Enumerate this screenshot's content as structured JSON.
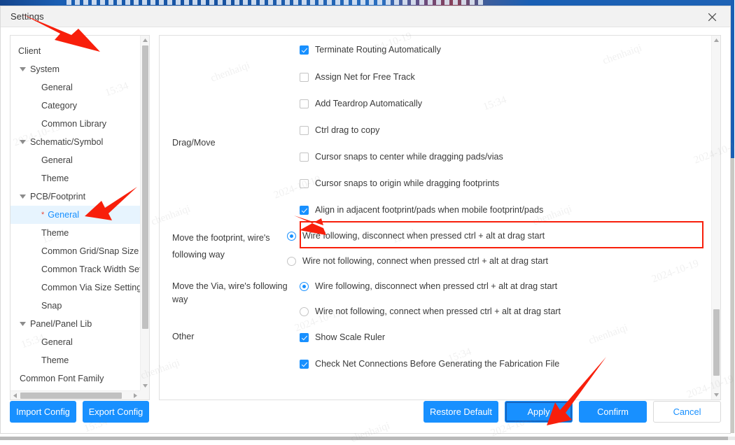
{
  "window": {
    "title": "Settings",
    "close_icon": "close-icon"
  },
  "sidebar": {
    "items": [
      {
        "label": "Client",
        "level": 0,
        "caret": false,
        "selected": false
      },
      {
        "label": "System",
        "level": 1,
        "caret": true,
        "selected": false
      },
      {
        "label": "General",
        "level": 2,
        "caret": false,
        "selected": false
      },
      {
        "label": "Category",
        "level": 2,
        "caret": false,
        "selected": false
      },
      {
        "label": "Common Library",
        "level": 2,
        "caret": false,
        "selected": false
      },
      {
        "label": "Schematic/Symbol",
        "level": 1,
        "caret": true,
        "selected": false
      },
      {
        "label": "General",
        "level": 2,
        "caret": false,
        "selected": false
      },
      {
        "label": "Theme",
        "level": 2,
        "caret": false,
        "selected": false
      },
      {
        "label": "PCB/Footprint",
        "level": 1,
        "caret": true,
        "selected": false
      },
      {
        "label": "General",
        "level": 2,
        "caret": false,
        "selected": true,
        "star": true
      },
      {
        "label": "Theme",
        "level": 2,
        "caret": false,
        "selected": false
      },
      {
        "label": "Common Grid/Snap Size Se",
        "level": 2,
        "caret": false,
        "selected": false
      },
      {
        "label": "Common Track Width Settin",
        "level": 2,
        "caret": false,
        "selected": false
      },
      {
        "label": "Common Via Size Setting",
        "level": 2,
        "caret": false,
        "selected": false
      },
      {
        "label": "Snap",
        "level": 2,
        "caret": false,
        "selected": false
      },
      {
        "label": "Panel/Panel Lib",
        "level": 1,
        "caret": true,
        "selected": false
      },
      {
        "label": "General",
        "level": 2,
        "caret": false,
        "selected": false
      },
      {
        "label": "Theme",
        "level": 2,
        "caret": false,
        "selected": false
      },
      {
        "label": "Common Font Family",
        "level": 1,
        "caret": false,
        "selected": false
      }
    ]
  },
  "main": {
    "groups": [
      {
        "label": "Drag/Move",
        "type": "checkbox",
        "options": [
          {
            "label": "Terminate Routing Automatically",
            "checked": true
          },
          {
            "label": "Assign Net for Free Track",
            "checked": false
          },
          {
            "label": "Add Teardrop Automatically",
            "checked": false
          },
          {
            "label": "Ctrl drag to copy",
            "checked": false
          },
          {
            "label": "Cursor snaps to center while dragging pads/vias",
            "checked": false
          },
          {
            "label": "Cursor snaps to origin while dragging footprints",
            "checked": false
          },
          {
            "label": "Align in adjacent footprint/pads when mobile footprint/pads",
            "checked": true,
            "highlighted": true
          }
        ]
      },
      {
        "label": "Move the footprint, wire's following way",
        "type": "radio",
        "options": [
          {
            "label": "Wire following, disconnect when pressed ctrl + alt at drag start",
            "selected": true
          },
          {
            "label": "Wire not following, connect when pressed ctrl + alt at drag start",
            "selected": false
          }
        ]
      },
      {
        "label": "Move the Via, wire's following way",
        "type": "radio",
        "options": [
          {
            "label": "Wire following, disconnect when pressed ctrl + alt at drag start",
            "selected": true
          },
          {
            "label": "Wire not following, connect when pressed ctrl + alt at drag start",
            "selected": false
          }
        ]
      },
      {
        "label": "Other",
        "type": "checkbox",
        "options": [
          {
            "label": "Show Scale Ruler",
            "checked": true
          },
          {
            "label": "Check Net Connections Before Generating the Fabrication File",
            "checked": true
          }
        ]
      }
    ]
  },
  "footer": {
    "import_label": "Import Config",
    "export_label": "Export Config",
    "restore_label": "Restore Default",
    "apply_label": "Apply",
    "confirm_label": "Confirm",
    "cancel_label": "Cancel"
  },
  "colors": {
    "accent": "#1890ff",
    "highlight": "#f81f0b",
    "selected_row": "#e7f4fe",
    "titlebar": "#f2f2f2"
  },
  "watermarks": [
    "2024-10-19",
    "15:34",
    "chenhaiqi"
  ]
}
